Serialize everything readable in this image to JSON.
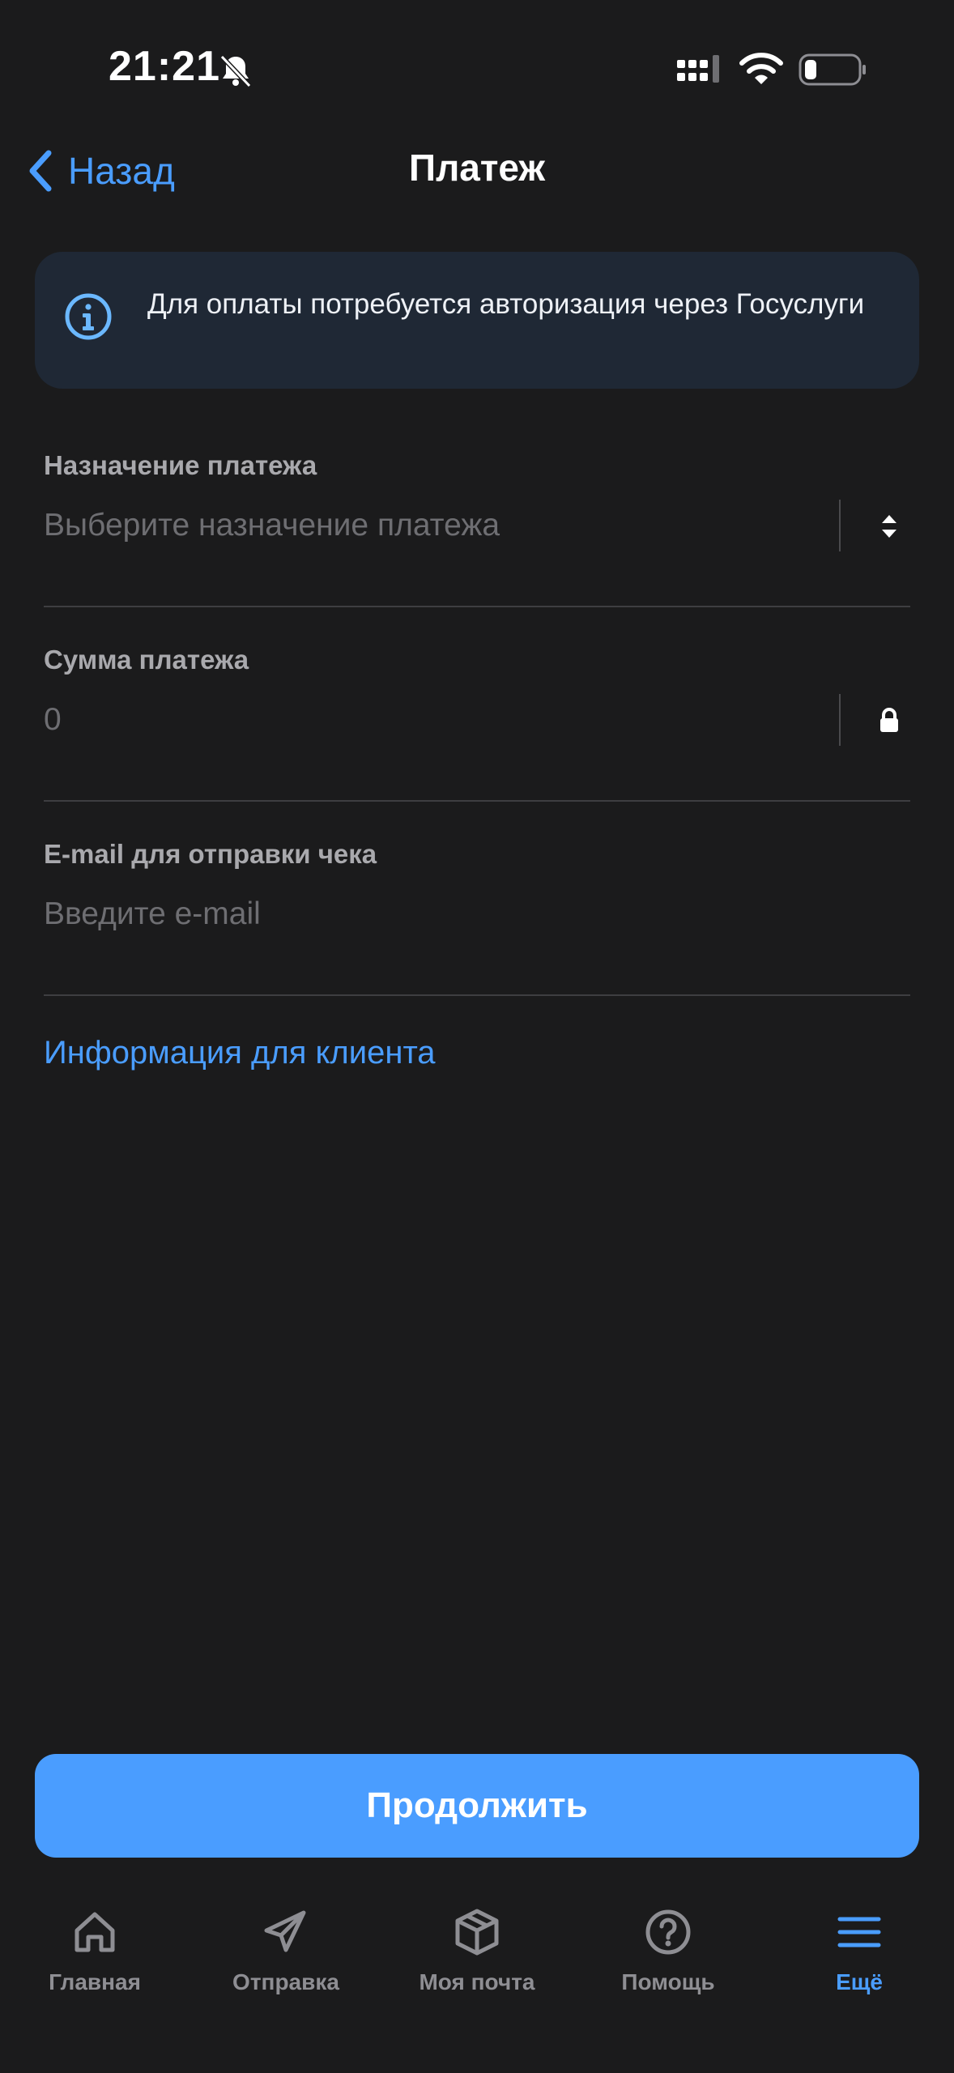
{
  "status_bar": {
    "time": "21:21"
  },
  "nav": {
    "back_label": "Назад",
    "title": "Платеж"
  },
  "info_banner": {
    "text": "Для оплаты потребуется авторизация через Госуслуги"
  },
  "form": {
    "purpose": {
      "label": "Назначение платежа",
      "placeholder": "Выберите назначение платежа",
      "value": ""
    },
    "amount": {
      "label": "Сумма платежа",
      "placeholder": "0",
      "value": ""
    },
    "email": {
      "label": "E-mail для отправки чека",
      "placeholder": "Введите e-mail",
      "value": ""
    }
  },
  "client_info_link": "Информация для клиента",
  "continue_button": "Продолжить",
  "tab_bar": {
    "items": [
      {
        "label": "Главная",
        "icon": "home-icon",
        "active": false
      },
      {
        "label": "Отправка",
        "icon": "send-icon",
        "active": false
      },
      {
        "label": "Моя почта",
        "icon": "parcel-icon",
        "active": false
      },
      {
        "label": "Помощь",
        "icon": "help-icon",
        "active": false
      },
      {
        "label": "Ещё",
        "icon": "menu-icon",
        "active": true
      }
    ]
  },
  "colors": {
    "background": "#1b1b1c",
    "accent": "#4a9dff",
    "banner_bg": "#1f2835",
    "inactive_tab": "#8e8e93"
  }
}
